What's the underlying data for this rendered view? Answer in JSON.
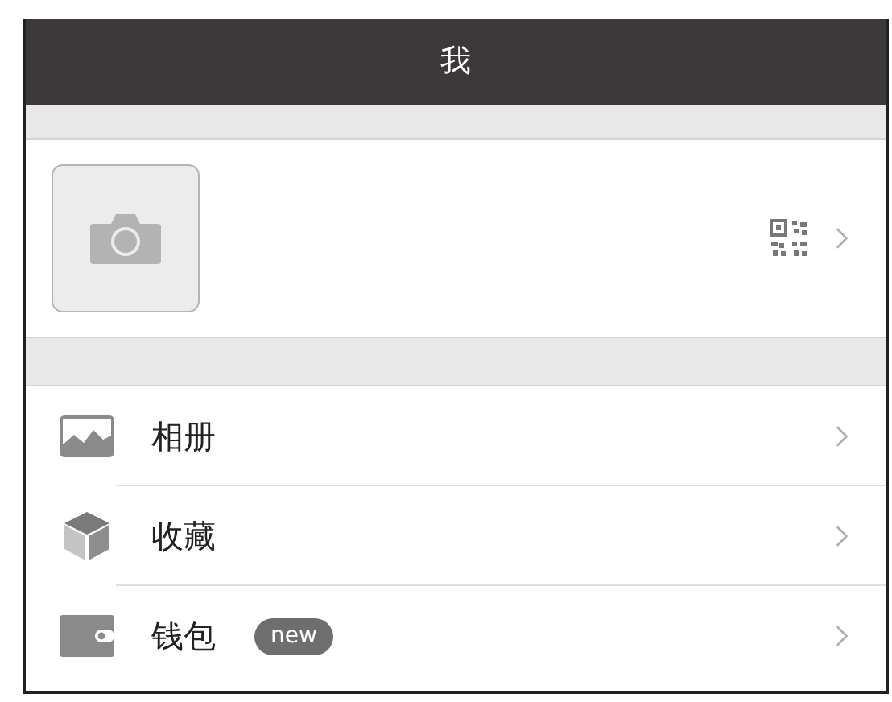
{
  "header": {
    "title": "我"
  },
  "menu": [
    {
      "kind": "album",
      "label": "相册"
    },
    {
      "kind": "favorites",
      "label": "收藏"
    },
    {
      "kind": "wallet",
      "label": "钱包",
      "badge": "new"
    }
  ]
}
